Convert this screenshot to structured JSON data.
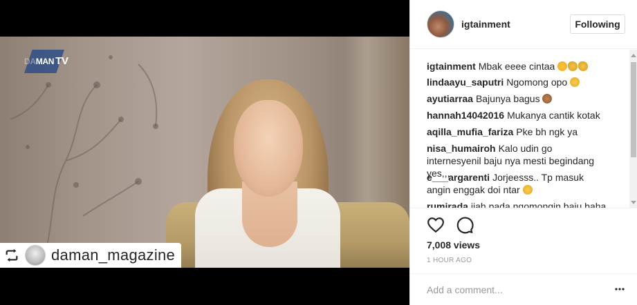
{
  "media": {
    "brand_top": "DA",
    "brand_main": "MAN",
    "brand_tv": "TV",
    "repost_label": "daman_magazine"
  },
  "post": {
    "username": "igtainment",
    "follow_label": "Following",
    "views": "7,008 views",
    "time": "1 HOUR AGO",
    "add_comment_placeholder": "Add a comment..."
  },
  "comments": [
    {
      "user": "igtainment",
      "text": "Mbak eeee cintaa",
      "emojis": [
        "love",
        "clap",
        "clap"
      ]
    },
    {
      "user": "lindaayu_saputri",
      "text": "Ngomong opo",
      "emojis": [
        "cry"
      ]
    },
    {
      "user": "ayutiarraa",
      "text": "Bajunya bagus",
      "emojis": [
        "monkey"
      ]
    },
    {
      "user": "hannah14042016",
      "text": "Mukanya cantik kotak",
      "emojis": []
    },
    {
      "user": "aqilla_mufia_fariza",
      "text": "Pke bh ngk ya",
      "emojis": []
    },
    {
      "user": "nisa_humairoh",
      "text": "Kalo udin go internesyenil baju nya mesti begindang yes,,,",
      "emojis": []
    },
    {
      "user": "e___argarenti",
      "text": "Jorjeesss.. Tp masuk angin enggak doi ntar",
      "emojis": [
        "sad"
      ]
    },
    {
      "user": "rumirada",
      "text": "jiah pada ngomongin baju baha",
      "emojis": []
    }
  ],
  "icons": {
    "like": "heart-icon",
    "comment": "comment-icon",
    "more": "more-icon",
    "repost": "repost-icon"
  },
  "colors": {
    "text": "#262626",
    "muted": "#999999",
    "border": "#efefef"
  }
}
